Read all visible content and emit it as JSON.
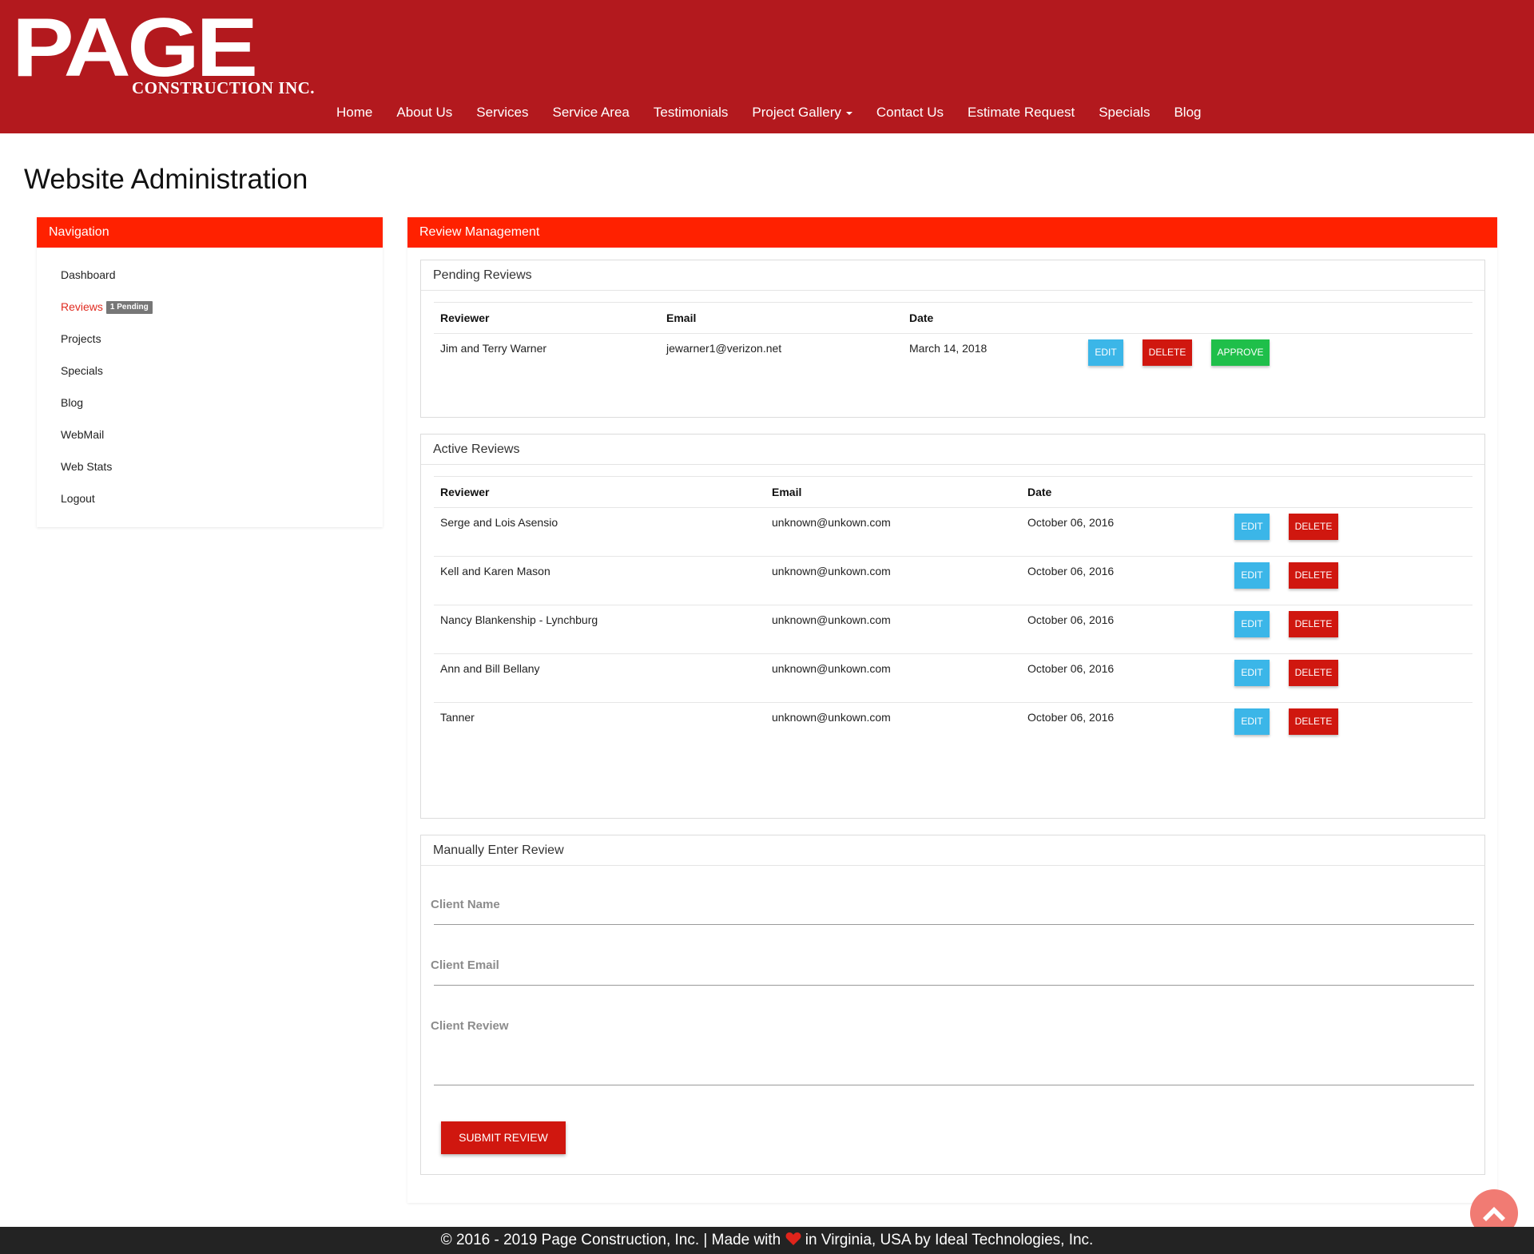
{
  "header": {
    "logo_main": "PAGE",
    "logo_sub": "CONSTRUCTION INC.",
    "nav": [
      "Home",
      "About Us",
      "Services",
      "Service Area",
      "Testimonials",
      "Project Gallery",
      "Contact Us",
      "Estimate Request",
      "Specials",
      "Blog"
    ]
  },
  "page_title": "Website Administration",
  "sidebar": {
    "title": "Navigation",
    "items": [
      "Dashboard",
      "Reviews",
      "Projects",
      "Specials",
      "Blog",
      "WebMail",
      "Web Stats",
      "Logout"
    ],
    "reviews_badge": "1 Pending"
  },
  "main": {
    "title": "Review Management",
    "pending": {
      "title": "Pending Reviews",
      "headers": [
        "Reviewer",
        "Email",
        "Date"
      ],
      "rows": [
        {
          "reviewer": "Jim and Terry Warner",
          "email": "jewarner1@verizon.net",
          "date": "March 14, 2018"
        }
      ],
      "edit_label": "EDIT",
      "delete_label": "DELETE",
      "approve_label": "APPROVE"
    },
    "active": {
      "title": "Active Reviews",
      "headers": [
        "Reviewer",
        "Email",
        "Date"
      ],
      "rows": [
        {
          "reviewer": "Serge and Lois Asensio",
          "email": "unknown@unkown.com",
          "date": "October 06, 2016"
        },
        {
          "reviewer": "Kell and Karen Mason",
          "email": "unknown@unkown.com",
          "date": "October 06, 2016"
        },
        {
          "reviewer": "Nancy Blankenship - Lynchburg",
          "email": "unknown@unkown.com",
          "date": "October 06, 2016"
        },
        {
          "reviewer": "Ann and Bill Bellany",
          "email": "unknown@unkown.com",
          "date": "October 06, 2016"
        },
        {
          "reviewer": "Tanner",
          "email": "unknown@unkown.com",
          "date": "October 06, 2016"
        }
      ],
      "edit_label": "EDIT",
      "delete_label": "DELETE"
    },
    "manual": {
      "title": "Manually Enter Review",
      "name_label": "Client Name",
      "email_label": "Client Email",
      "review_label": "Client Review",
      "submit_label": "SUBMIT REVIEW"
    }
  },
  "footer": {
    "text_before": "© 2016 - 2019 Page Construction, Inc. | Made with",
    "text_after": "in Virginia, USA by Ideal Technologies, Inc."
  },
  "icons": {
    "scroll_top": "chevron-up-icon",
    "heart": "heart-icon"
  },
  "colors": {
    "header": "#b3191e",
    "panel": "#ff2100",
    "edit": "#3bb6e8",
    "delete": "#d0170f",
    "approve": "#1fbf4a"
  }
}
